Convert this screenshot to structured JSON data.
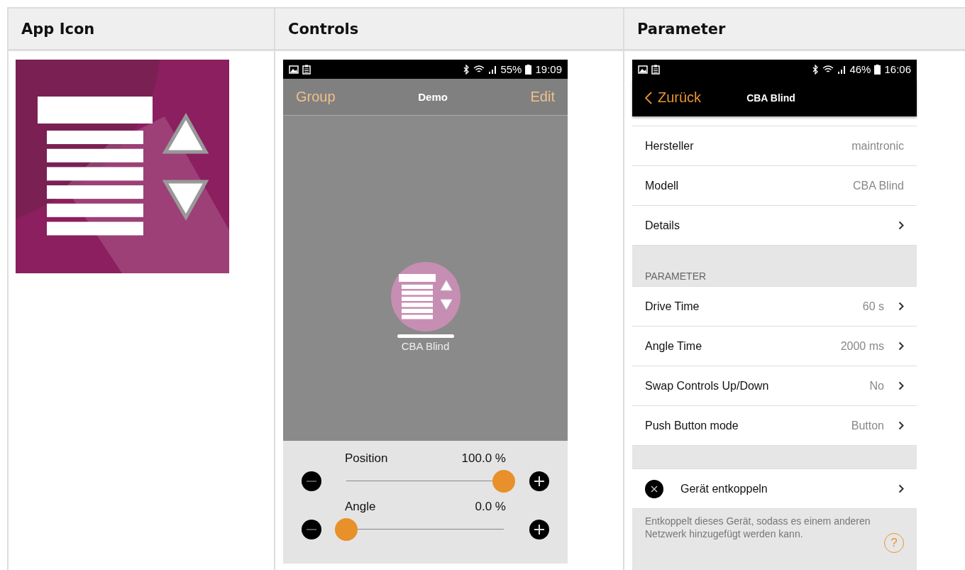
{
  "table": {
    "columns": [
      "App Icon",
      "Controls",
      "Parameter"
    ]
  },
  "controls_screen": {
    "status_bar": {
      "battery": "55%",
      "time": "19:09"
    },
    "nav": {
      "left": "Group",
      "title": "Demo",
      "right": "Edit"
    },
    "device": {
      "name": "CBA Blind",
      "selected": true
    },
    "sliders": [
      {
        "label": "Position",
        "reading": "100.0 %",
        "level": 1
      },
      {
        "label": "Angle",
        "reading": "0.0 %",
        "level": 0
      }
    ]
  },
  "parameter_screen": {
    "status_bar": {
      "battery": "46%",
      "time": "16:06"
    },
    "back": "Zurück",
    "title": "CBA Blind",
    "info_rows": [
      {
        "kind": "value",
        "label": "Hersteller",
        "value": "maintronic"
      },
      {
        "kind": "value",
        "label": "Modell",
        "value": "CBA Blind"
      },
      {
        "kind": "link",
        "label": "Details"
      }
    ],
    "section_header": "PARAMETER",
    "parameter_rows": [
      {
        "kind": "value_link",
        "label": "Drive Time",
        "value": "60 s"
      },
      {
        "kind": "value_link",
        "label": "Angle Time",
        "value": "2000 ms"
      },
      {
        "kind": "value_link",
        "label": "Swap Controls Up/Down",
        "value": "No"
      },
      {
        "kind": "value_link",
        "label": "Push Button mode",
        "value": "Button"
      }
    ],
    "action": {
      "label": "Gerät entkoppeln"
    },
    "footer_note": "Entkoppelt dieses Gerät, sodass es einem anderen Netzwerk hinzugefügt werden kann.",
    "help_button": "?"
  }
}
